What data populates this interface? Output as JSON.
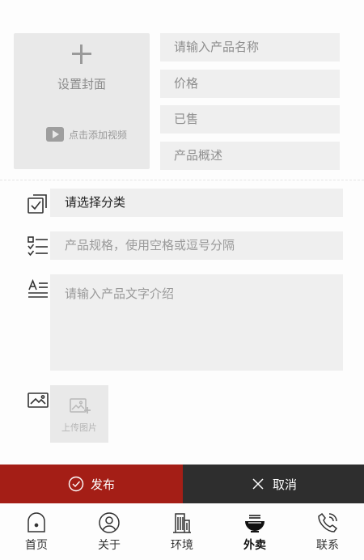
{
  "cover": {
    "label": "设置封面",
    "video_label": "点击添加视频"
  },
  "fields": {
    "name_placeholder": "请输入产品名称",
    "price_placeholder": "价格",
    "sold_placeholder": "已售",
    "summary_placeholder": "产品概述",
    "category_value": "请选择分类",
    "spec_placeholder": "产品规格，使用空格或逗号分隔",
    "desc_placeholder": "请输入产品文字介绍"
  },
  "upload": {
    "label": "上传图片"
  },
  "actions": {
    "publish_label": "发布",
    "cancel_label": "取消"
  },
  "tabbar": {
    "active_index": 3,
    "items": [
      {
        "label": "首页",
        "icon": "home-icon"
      },
      {
        "label": "关于",
        "icon": "user-icon"
      },
      {
        "label": "环境",
        "icon": "building-icon"
      },
      {
        "label": "外卖",
        "icon": "noodle-bowl-icon"
      },
      {
        "label": "联系",
        "icon": "phone-icon"
      }
    ]
  },
  "colors": {
    "publish": "#a41e16",
    "cancel": "#2e2e2e",
    "field_bg": "#efefef"
  }
}
